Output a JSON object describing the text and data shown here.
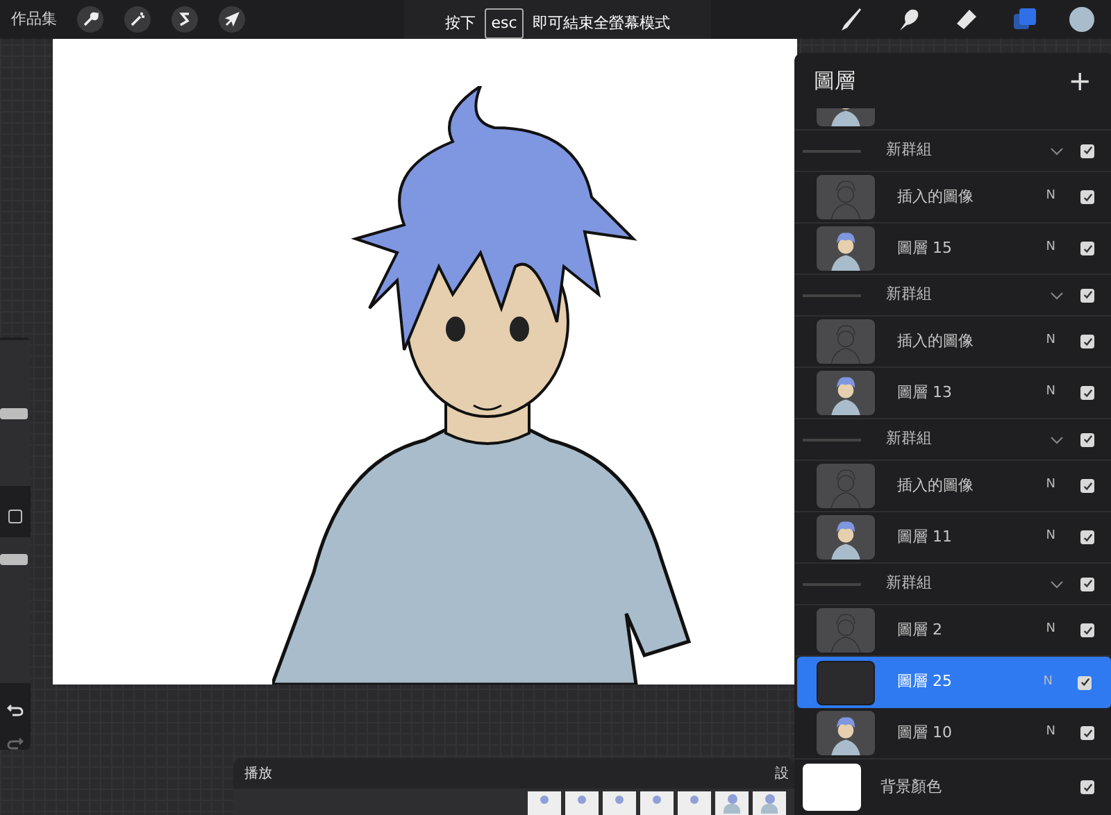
{
  "top_bar": {
    "gallery_label": "作品集"
  },
  "fullscreen_hint": {
    "before": "按下",
    "key": "esc",
    "after": "即可結束全螢幕模式"
  },
  "tools": [
    {
      "kind": "brush",
      "selected": false
    },
    {
      "kind": "smudge",
      "selected": false
    },
    {
      "kind": "eraser",
      "selected": false
    },
    {
      "kind": "layers",
      "selected": true
    }
  ],
  "sidebar": {
    "size_slider": {
      "level": 0.5
    },
    "opacity_slider": {
      "level": 0.85
    }
  },
  "layers_panel": {
    "title": "圖層",
    "add_label": "+",
    "rows": [
      {
        "kind": "partial",
        "thumb": {
          "kind": "character"
        }
      },
      {
        "kind": "group",
        "name": "新群組",
        "checked": true
      },
      {
        "kind": "layer",
        "name": "插入的圖像",
        "thumb": {
          "kind": "sketch"
        },
        "blend": "N",
        "checked": true,
        "selected": false
      },
      {
        "kind": "layer",
        "name": "圖層 15",
        "thumb": {
          "kind": "character"
        },
        "blend": "N",
        "checked": true,
        "selected": false
      },
      {
        "kind": "group",
        "name": "新群組",
        "checked": true
      },
      {
        "kind": "layer",
        "name": "插入的圖像",
        "thumb": {
          "kind": "sketch"
        },
        "blend": "N",
        "checked": true,
        "selected": false
      },
      {
        "kind": "layer",
        "name": "圖層 13",
        "thumb": {
          "kind": "character"
        },
        "blend": "N",
        "checked": true,
        "selected": false
      },
      {
        "kind": "group",
        "name": "新群組",
        "checked": true
      },
      {
        "kind": "layer",
        "name": "插入的圖像",
        "thumb": {
          "kind": "sketch"
        },
        "blend": "N",
        "checked": true,
        "selected": false
      },
      {
        "kind": "layer",
        "name": "圖層 11",
        "thumb": {
          "kind": "character"
        },
        "blend": "N",
        "checked": true,
        "selected": false
      },
      {
        "kind": "group",
        "name": "新群組",
        "checked": true
      },
      {
        "kind": "layer",
        "name": "圖層 2",
        "thumb": {
          "kind": "sketch"
        },
        "blend": "N",
        "checked": true,
        "selected": false
      },
      {
        "kind": "layer",
        "name": "圖層 25",
        "thumb": {
          "kind": "dark"
        },
        "blend": "N",
        "checked": true,
        "selected": true
      },
      {
        "kind": "layer",
        "name": "圖層 10",
        "thumb": {
          "kind": "character"
        },
        "blend": "N",
        "checked": true,
        "selected": false
      },
      {
        "kind": "background",
        "name": "背景顏色",
        "thumb": {
          "kind": "white"
        },
        "checked": true
      }
    ]
  },
  "animation_panel": {
    "title": "播放",
    "settings_label": "設",
    "frames": [
      {
        "kind": "head"
      },
      {
        "kind": "head"
      },
      {
        "kind": "head"
      },
      {
        "kind": "head"
      },
      {
        "kind": "head"
      },
      {
        "kind": "figure"
      },
      {
        "kind": "figure"
      }
    ]
  }
}
